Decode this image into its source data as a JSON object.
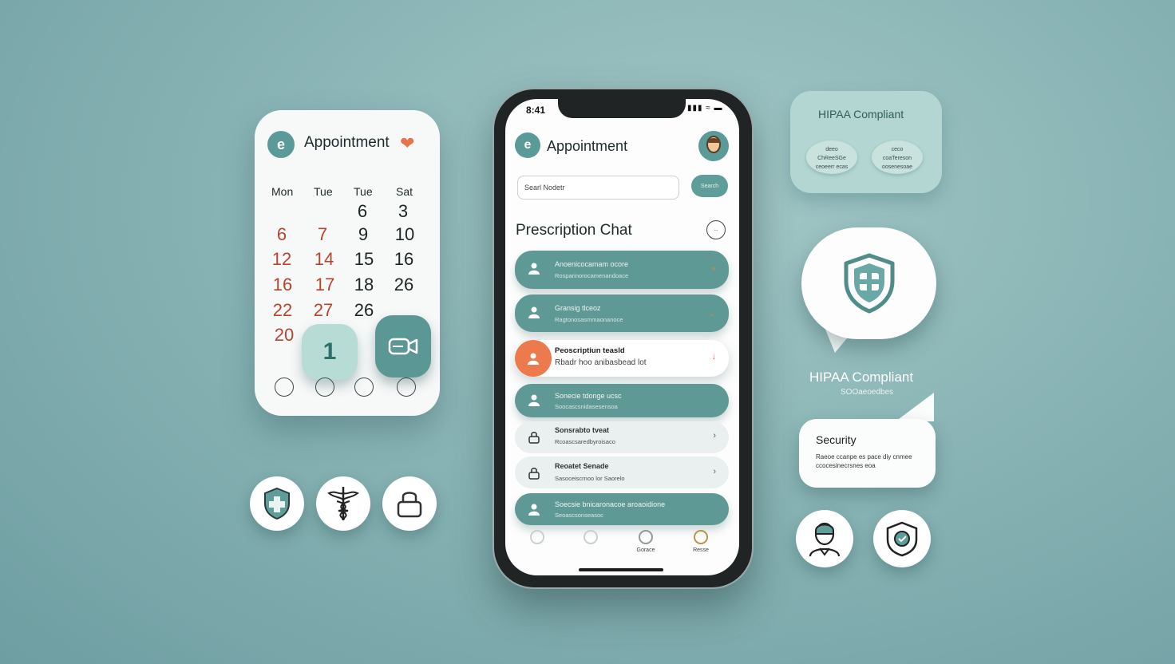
{
  "calendar_card": {
    "logo": "e",
    "title": "Appointment",
    "days": [
      "Mon",
      "Tue",
      "Tue",
      "Sat"
    ],
    "rows": [
      [
        "",
        "",
        "6",
        "3"
      ],
      [
        "6",
        "7",
        "9",
        "10"
      ],
      [
        "12",
        "14",
        "15",
        "16"
      ],
      [
        "16",
        "17",
        "18",
        "26"
      ],
      [
        "22",
        "27",
        "26",
        ""
      ],
      [
        "20",
        "",
        "",
        ""
      ]
    ],
    "selected_day": "1",
    "bottom_dots": [
      "",
      "",
      "",
      ""
    ]
  },
  "phone": {
    "time": "8:41",
    "app_logo": "e",
    "app_title": "Appointment",
    "search": {
      "value": "Searl Nodetr",
      "button_label": "Search"
    },
    "section_title": "Prescription Chat",
    "more_label": "...",
    "chat_items": [
      {
        "name": "Anoenicocamam ocore",
        "sub": "Rosparinorocamenandoace",
        "style": "teal"
      },
      {
        "name": "Gransig tlceoz",
        "sub": "Ragtonosasmmaonanoce",
        "style": "teal"
      },
      {
        "name": "Peoscriptiun teasld",
        "sub": "Rbadr hoo anibasbead lot",
        "style": "white"
      },
      {
        "name": "Sonecie tdonge ucsc",
        "sub": "Soocascsnidasesensoa",
        "style": "teal"
      },
      {
        "name": "Sonsrabto tveat",
        "sub": "Rcoascsaredbyroisaco",
        "style": "light"
      },
      {
        "name": "Reoatet Senade",
        "sub": "Sasoceiscrnoo lor Saorelo",
        "style": "light"
      },
      {
        "name": "Soecsie bnicaronacoe aroaoidione",
        "sub": "Seoascsonseasoc",
        "style": "teal"
      }
    ],
    "tabbar": [
      {
        "label": ""
      },
      {
        "label": ""
      },
      {
        "label": "Gorace"
      },
      {
        "label": "Resse"
      }
    ]
  },
  "hipaa_card": {
    "title": "HIPAA Compliant",
    "pills": [
      {
        "line1": "deeo",
        "line2": "ChReeSGe",
        "line3": "ceoeerr ecas"
      },
      {
        "line1": "ceco",
        "line2": "coaTereson",
        "line3": "oosenesoae"
      }
    ]
  },
  "hipaa_badge": {
    "label": "HIPAA Compliant",
    "sub": "SOOaeoedbes"
  },
  "security_card": {
    "title": "Security",
    "text": "Raeoe ccanpe es pace diy cnmee ccocesinecrsnes eoa"
  },
  "colors": {
    "teal": "#5f9996",
    "orange": "#ec7a4d",
    "red_day": "#b8442e",
    "background": "#8cb6b7"
  }
}
